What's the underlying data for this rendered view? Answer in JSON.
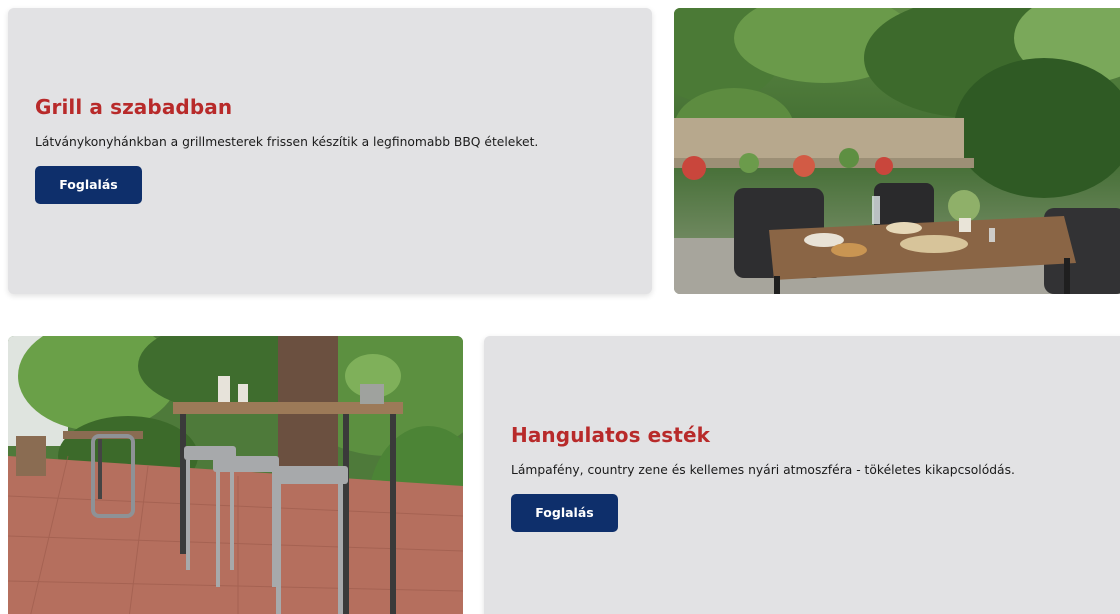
{
  "sections": [
    {
      "title": "Grill a szabadban",
      "description": "Látványkonyhánkban a grillmesterek frissen készítik a legfinomabb BBQ ételeket.",
      "button_label": "Foglalás"
    },
    {
      "title": "Hangulatos esték",
      "description": "Lámpafény, country zene és kellemes nyári atmoszféra - tökéletes kikapcsolódás.",
      "button_label": "Foglalás"
    }
  ],
  "colors": {
    "card_background": "#e2e2e4",
    "title_red": "#b82a2a",
    "button_navy": "#0e2f6b",
    "text_dark": "#1b1b1b"
  }
}
